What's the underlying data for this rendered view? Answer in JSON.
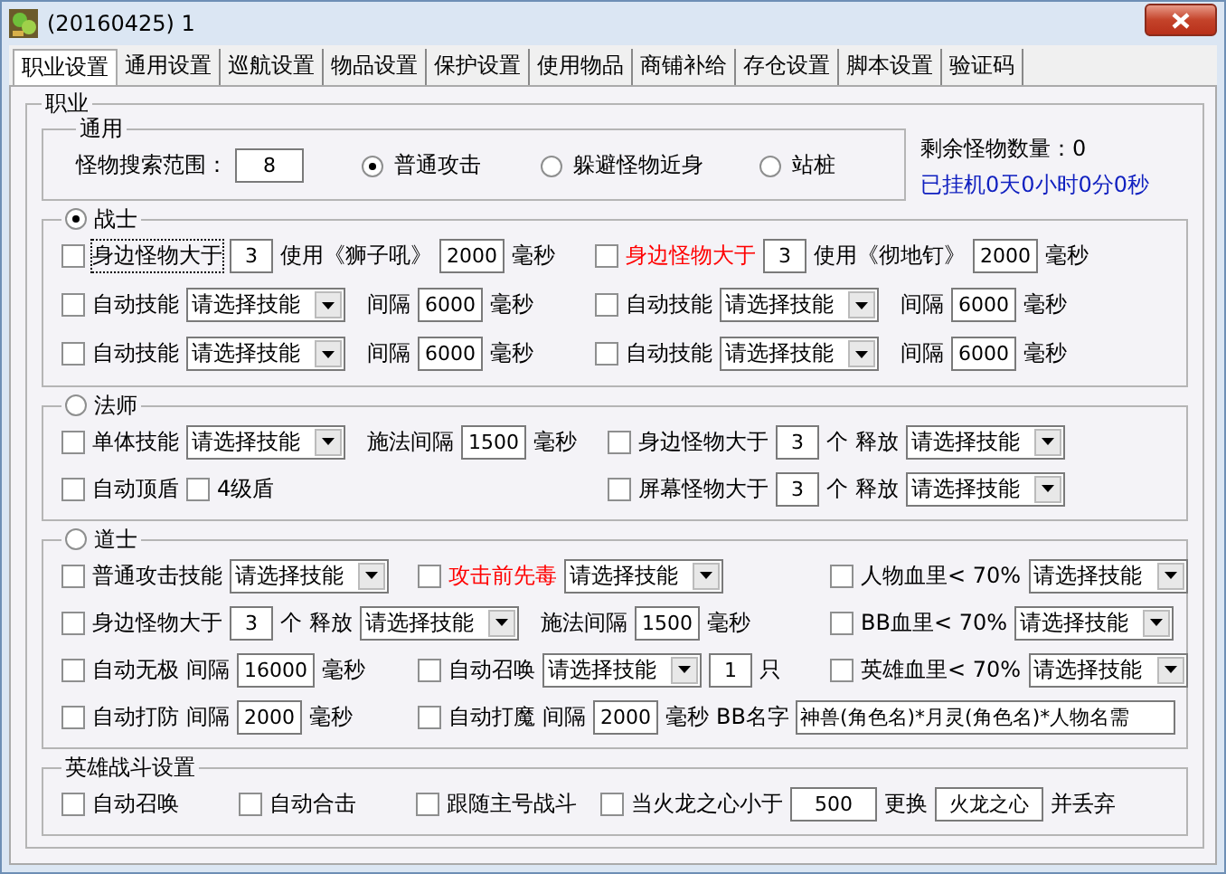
{
  "window": {
    "title": "(20160425) 1"
  },
  "tabs": [
    {
      "label": "职业设置",
      "selected": true
    },
    {
      "label": "通用设置",
      "selected": false
    },
    {
      "label": "巡航设置",
      "selected": false
    },
    {
      "label": "物品设置",
      "selected": false
    },
    {
      "label": "保护设置",
      "selected": false
    },
    {
      "label": "使用物品",
      "selected": false
    },
    {
      "label": "商铺补给",
      "selected": false
    },
    {
      "label": "存仓设置",
      "selected": false
    },
    {
      "label": "脚本设置",
      "selected": false
    },
    {
      "label": "验证码",
      "selected": false
    }
  ],
  "job_group": {
    "title": "职业",
    "status": {
      "remaining": "剩余怪物数量：0",
      "uptime": "已挂机0天0小时0分0秒"
    },
    "sections": [
      {
        "kind": "general",
        "title": "通用",
        "rows": [
          [
            [
              {
                "kind": "label",
                "text": "怪物搜索范围："
              },
              {
                "kind": "input",
                "value": "8"
              }
            ],
            [
              {
                "kind": "radio",
                "text": "普通攻击",
                "selected": true
              }
            ],
            [
              {
                "kind": "radio",
                "text": "躲避怪物近身",
                "selected": false
              }
            ],
            [
              {
                "kind": "radio",
                "text": "站桩",
                "selected": false
              }
            ]
          ]
        ]
      },
      {
        "kind": "warrior",
        "title": "战士",
        "selected": true,
        "rows": [
          [
            [
              {
                "kind": "check",
                "text": "身边怪物大于",
                "checked": false,
                "focused": true
              },
              {
                "kind": "input",
                "value": "3"
              },
              {
                "kind": "label",
                "text": "使用《狮子吼》"
              },
              {
                "kind": "input",
                "value": "2000"
              },
              {
                "kind": "label",
                "text": "毫秒"
              }
            ],
            [
              {
                "kind": "check",
                "text": "身边怪物大于",
                "checked": false,
                "color": "#ff0000"
              },
              {
                "kind": "input",
                "value": "3"
              },
              {
                "kind": "label",
                "text": "使用《彻地钉》"
              },
              {
                "kind": "input",
                "value": "2000"
              },
              {
                "kind": "label",
                "text": "毫秒"
              }
            ]
          ],
          [
            [
              {
                "kind": "check",
                "text": "自动技能",
                "checked": false
              },
              {
                "kind": "select",
                "value": "请选择技能"
              },
              {
                "kind": "label",
                "text": "间隔"
              },
              {
                "kind": "input",
                "value": "6000"
              },
              {
                "kind": "label",
                "text": "毫秒"
              }
            ],
            [
              {
                "kind": "check",
                "text": "自动技能",
                "checked": false
              },
              {
                "kind": "select",
                "value": "请选择技能"
              },
              {
                "kind": "label",
                "text": "间隔"
              },
              {
                "kind": "input",
                "value": "6000"
              },
              {
                "kind": "label",
                "text": "毫秒"
              }
            ]
          ],
          [
            [
              {
                "kind": "check",
                "text": "自动技能",
                "checked": false
              },
              {
                "kind": "select",
                "value": "请选择技能"
              },
              {
                "kind": "label",
                "text": "间隔"
              },
              {
                "kind": "input",
                "value": "6000"
              },
              {
                "kind": "label",
                "text": "毫秒"
              }
            ],
            [
              {
                "kind": "check",
                "text": "自动技能",
                "checked": false
              },
              {
                "kind": "select",
                "value": "请选择技能"
              },
              {
                "kind": "label",
                "text": "间隔"
              },
              {
                "kind": "input",
                "value": "6000"
              },
              {
                "kind": "label",
                "text": "毫秒"
              }
            ]
          ]
        ]
      },
      {
        "kind": "mage",
        "title": "法师",
        "selected": false,
        "rows": [
          [
            [
              {
                "kind": "check",
                "text": "单体技能",
                "checked": false
              },
              {
                "kind": "select",
                "value": "请选择技能"
              },
              {
                "kind": "label",
                "text": "施法间隔"
              },
              {
                "kind": "input",
                "value": "1500"
              },
              {
                "kind": "label",
                "text": "毫秒"
              }
            ],
            [
              {
                "kind": "check",
                "text": "身边怪物大于",
                "checked": false
              },
              {
                "kind": "input",
                "value": "3"
              },
              {
                "kind": "label",
                "text": "个"
              },
              {
                "kind": "label",
                "text": "释放"
              },
              {
                "kind": "select",
                "value": "请选择技能"
              }
            ]
          ],
          [
            [
              {
                "kind": "check",
                "text": "自动顶盾",
                "checked": false
              },
              {
                "kind": "check",
                "text": "4级盾",
                "checked": false
              }
            ],
            [
              {
                "kind": "check",
                "text": "屏幕怪物大于",
                "checked": false
              },
              {
                "kind": "input",
                "value": "3"
              },
              {
                "kind": "label",
                "text": "个"
              },
              {
                "kind": "label",
                "text": "释放"
              },
              {
                "kind": "select",
                "value": "请选择技能"
              }
            ]
          ]
        ]
      },
      {
        "kind": "taoist",
        "title": "道士",
        "selected": false,
        "rows": [
          [
            [
              {
                "kind": "check",
                "text": "普通攻击技能",
                "checked": false
              },
              {
                "kind": "select",
                "value": "请选择技能"
              }
            ],
            [
              {
                "kind": "check",
                "text": "攻击前先毒",
                "checked": false,
                "color": "#ff0000"
              },
              {
                "kind": "select",
                "value": "请选择技能"
              }
            ],
            [
              {
                "kind": "check",
                "text": "人物血里< 70%",
                "checked": false
              },
              {
                "kind": "select",
                "value": "请选择技能"
              }
            ]
          ],
          [
            [
              {
                "kind": "check",
                "text": "身边怪物大于",
                "checked": false
              },
              {
                "kind": "input",
                "value": "3"
              },
              {
                "kind": "label",
                "text": "个"
              },
              {
                "kind": "label",
                "text": "释放"
              },
              {
                "kind": "select",
                "value": "请选择技能"
              },
              {
                "kind": "label",
                "text": "施法间隔"
              },
              {
                "kind": "input",
                "value": "1500"
              },
              {
                "kind": "label",
                "text": "毫秒"
              }
            ],
            [
              {
                "kind": "check",
                "text": "BB血里< 70%",
                "checked": false
              },
              {
                "kind": "select",
                "value": "请选择技能"
              }
            ]
          ],
          [
            [
              {
                "kind": "check",
                "text": "自动无极",
                "checked": false
              },
              {
                "kind": "label",
                "text": "间隔"
              },
              {
                "kind": "input",
                "value": "16000"
              },
              {
                "kind": "label",
                "text": "毫秒"
              }
            ],
            [
              {
                "kind": "check",
                "text": "自动召唤",
                "checked": false
              },
              {
                "kind": "select",
                "value": "请选择技能"
              },
              {
                "kind": "input",
                "value": "1"
              },
              {
                "kind": "label",
                "text": "只"
              }
            ],
            [
              {
                "kind": "check",
                "text": "英雄血里< 70%",
                "checked": false
              },
              {
                "kind": "select",
                "value": "请选择技能"
              }
            ]
          ],
          [
            [
              {
                "kind": "check",
                "text": "自动打防",
                "checked": false
              },
              {
                "kind": "label",
                "text": "间隔"
              },
              {
                "kind": "input",
                "value": "2000"
              },
              {
                "kind": "label",
                "text": "毫秒"
              }
            ],
            [
              {
                "kind": "check",
                "text": "自动打魔",
                "checked": false
              },
              {
                "kind": "label",
                "text": "间隔"
              },
              {
                "kind": "input",
                "value": "2000"
              },
              {
                "kind": "label",
                "text": "毫秒"
              },
              {
                "kind": "label",
                "text": "BB名字"
              },
              {
                "kind": "input",
                "value": "神兽(角色名)*月灵(角色名)*人物名需"
              }
            ]
          ]
        ]
      },
      {
        "kind": "hero",
        "title": "英雄战斗设置",
        "rows": [
          [
            [
              {
                "kind": "check",
                "text": "自动召唤",
                "checked": false
              }
            ],
            [
              {
                "kind": "check",
                "text": "自动合击",
                "checked": false
              }
            ],
            [
              {
                "kind": "check",
                "text": "跟随主号战斗",
                "checked": false
              }
            ],
            [
              {
                "kind": "check",
                "text": "当火龙之心小于",
                "checked": false
              },
              {
                "kind": "input",
                "value": "500"
              },
              {
                "kind": "label",
                "text": "更换"
              },
              {
                "kind": "input",
                "value": "火龙之心"
              },
              {
                "kind": "label",
                "text": "并丢弃"
              }
            ]
          ]
        ]
      }
    ]
  }
}
